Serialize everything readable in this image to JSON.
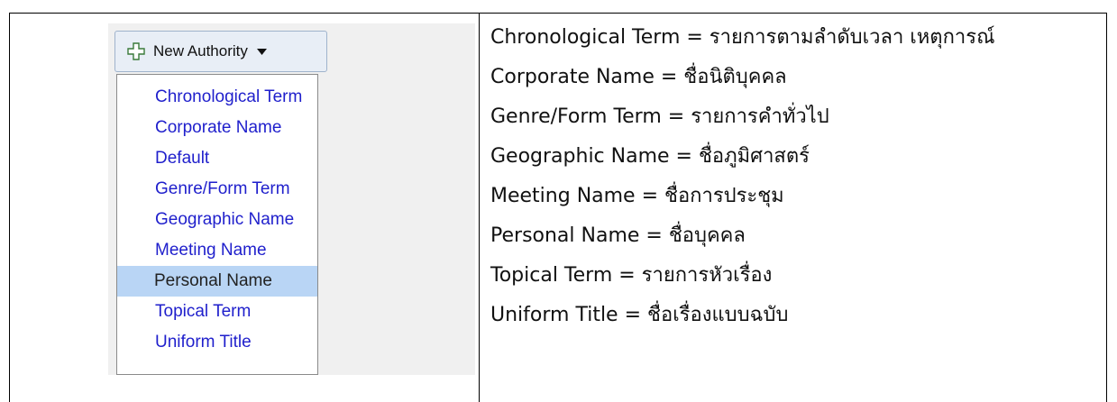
{
  "button": {
    "label": "New Authority",
    "icon": "plus-outline-icon",
    "caret_icon": "caret-down-icon"
  },
  "menu": {
    "items": [
      {
        "label": "Chronological Term",
        "selected": false
      },
      {
        "label": "Corporate Name",
        "selected": false
      },
      {
        "label": "Default",
        "selected": false
      },
      {
        "label": "Genre/Form Term",
        "selected": false
      },
      {
        "label": "Geographic Name",
        "selected": false
      },
      {
        "label": "Meeting Name",
        "selected": false
      },
      {
        "label": "Personal Name",
        "selected": true
      },
      {
        "label": "Topical Term",
        "selected": false
      },
      {
        "label": "Uniform Title",
        "selected": false
      }
    ]
  },
  "definitions": [
    "Chronological Term = รายการตามลำดับเวลา เหตุการณ์",
    "Corporate Name = ชื่อนิติบุคคล",
    "Genre/Form Term = รายการคำทั่วไป",
    "Geographic Name = ชื่อภูมิศาสตร์",
    "Meeting Name = ชื่อการประชุม",
    "Personal Name = ชื่อบุคคล",
    "Topical Term = รายการหัวเรื่อง",
    "Uniform Title = ชื่อเรื่องแบบฉบับ"
  ],
  "colors": {
    "menu_link": "#1f1fcc",
    "menu_selected_bg": "#b9d5f5",
    "button_bg": "#e8eef6"
  }
}
